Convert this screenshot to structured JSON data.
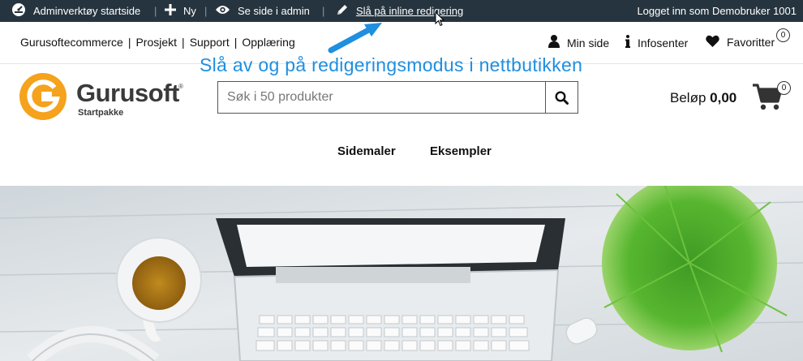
{
  "adminbar": {
    "dashboard_label": "Adminverktøy startside",
    "new_label": "Ny",
    "view_label": "Se side i admin",
    "inline_edit_label": "Slå på inline redigering",
    "logged_in_text": "Logget inn som Demobruker 1001",
    "separator": "|"
  },
  "toplinks": {
    "left": [
      "Gurusoftecommerce",
      "Prosjekt",
      "Support",
      "Opplæring"
    ],
    "my_page": "Min side",
    "info_center": "Infosenter",
    "favorites": "Favoritter",
    "favorites_count": "0"
  },
  "annotation": "Slå av og på redigeringsmodus i nettbutikken",
  "logo": {
    "name": "Gurusoft",
    "tagline": "Startpakke",
    "color": "#f5a21c"
  },
  "search": {
    "placeholder": "Søk i 50 produkter"
  },
  "cart": {
    "label": "Beløp",
    "amount": "0,00",
    "count": "0"
  },
  "nav": {
    "items": [
      "Sidemaler",
      "Eksempler"
    ]
  },
  "colors": {
    "adminbar_bg": "#26343f",
    "accent": "#1f8fe0"
  }
}
